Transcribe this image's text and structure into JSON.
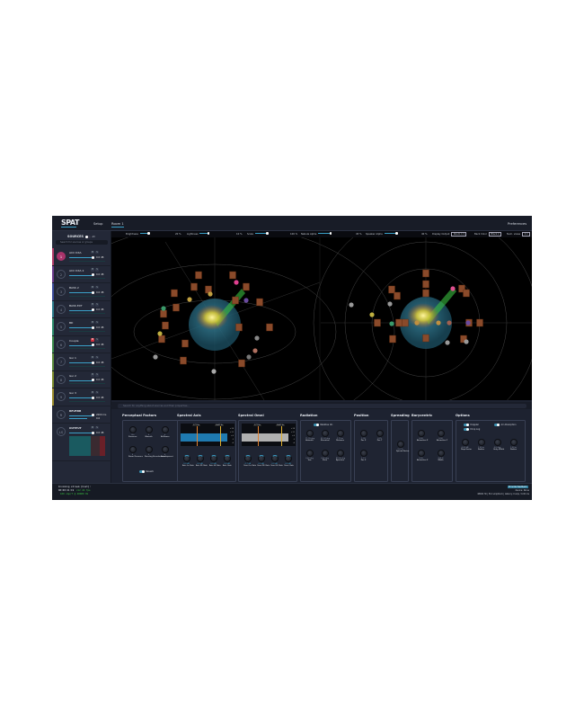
{
  "app": {
    "logo": "SPAT",
    "tabs": [
      "Setup",
      "Room 1"
    ],
    "active_tab": "Room 1",
    "preferences": "Preferences"
  },
  "sidebar": {
    "title": "SOURCES",
    "all_label": "All",
    "search_placeholder": "Search for sources or groups",
    "sources": [
      {
        "num": "1",
        "name": "ACC DXA",
        "value": "0.0 dB",
        "color": "#b03a68",
        "active": true
      },
      {
        "num": "2",
        "name": "ACC DXA 2",
        "value": "0.0 dB",
        "color": "#6a3a8a"
      },
      {
        "num": "3",
        "name": "BASS 2",
        "value": "0.0 dB",
        "color": "#3a4a9a"
      },
      {
        "num": "4",
        "name": "BASS EXT",
        "value": "0.0 dB",
        "color": "#2a7a8a"
      },
      {
        "num": "5",
        "name": "BD",
        "value": "0.0 dB",
        "color": "#2a8a6a"
      },
      {
        "num": "6",
        "name": "Couple",
        "value": "0.0 dB",
        "color": "#3a8a4a",
        "badge": true
      },
      {
        "num": "7",
        "name": "Gui 1",
        "value": "0.0 dB",
        "color": "#5a8a3a"
      },
      {
        "num": "8",
        "name": "Gui 2",
        "value": "0.0 dB",
        "color": "#7a8a2a"
      },
      {
        "num": "9",
        "name": "Gui 3",
        "value": "0.0 dB",
        "color": "#9a8a2a"
      }
    ],
    "reverb": {
      "num": "R",
      "name": "REVERB",
      "value1": "2000 ms",
      "value2": "0.0"
    },
    "output": {
      "num": "LS",
      "name": "OUTPUT",
      "value": "0.0 dB"
    },
    "btn_m": "M",
    "btn_s": "S"
  },
  "toolbar": {
    "brightness_label": "Brightness",
    "brightness": "20 %",
    "lightness_label": "Lightness",
    "lightness": "10 %",
    "scale_label": "Scale",
    "scale": "100 %",
    "nebula_label": "Nebula Alpha",
    "nebula": "45 %",
    "speaker_label": "Speaker Alpha",
    "speaker": "40 %",
    "display_output_label": "Display Output",
    "display_output": "Room 1",
    "back_color_label": "Back Color",
    "back_color": "Black",
    "num_views_label": "Num. views",
    "num_views": "2"
  },
  "search": {
    "placeholder": "Search for anything about sources and their properties..."
  },
  "panels": {
    "perceptual": {
      "title": "Perceptual Factors",
      "knobs": [
        {
          "v": "120",
          "l": "Presence"
        },
        {
          "v": "0",
          "l": "Warmth"
        },
        {
          "v": "0",
          "l": "Brilliance"
        },
        {
          "v": "0",
          "l": "Room Presence"
        },
        {
          "v": "0",
          "l": "Running Reverberance"
        },
        {
          "v": "0",
          "l": "Envelopment"
        }
      ],
      "toggle": "Reverb"
    },
    "spectral_axis": {
      "title": "Spectral Axis",
      "f1": "277 Hz",
      "f2": "3447 Hz",
      "scale": [
        "+18",
        "+12",
        "+6",
        "0",
        "-6"
      ],
      "knobs": [
        {
          "v": "0.0 dB",
          "l": "Axis Lo Gain"
        },
        {
          "v": "0.0 dB",
          "l": "Axis Mi Gain"
        },
        {
          "v": "0.0 dB",
          "l": "Axis Hi Gain"
        },
        {
          "v": "0.0 dB",
          "l": "Axis Gain"
        }
      ]
    },
    "spectral_omni": {
      "title": "Spectral Omni",
      "f1": "277 Hz",
      "f2": "3447 Hz",
      "scale": [
        "+18",
        "+12",
        "+6",
        "0",
        "-6"
      ],
      "knobs": [
        {
          "v": "-1.7 dB",
          "l": "Omni Lo Gain"
        },
        {
          "v": "0.0 dB",
          "l": "Omni Mi Gain"
        },
        {
          "v": "0.0 dB",
          "l": "Omni Hi Gain"
        },
        {
          "v": "0.0 dB",
          "l": "Omni Gain"
        }
      ]
    },
    "radiation": {
      "title": "Radiation",
      "toggle": "Relative dir.",
      "knobs": [
        {
          "v": "71.95 deg",
          "l": "Azimuth"
        },
        {
          "v": "51.02 deg",
          "l": "Elevation"
        },
        {
          "v": "1.70 m",
          "l": "Distance"
        },
        {
          "v": "0.00 deg",
          "l": "Yaw"
        },
        {
          "v": "0.00 deg",
          "l": "Pitch"
        },
        {
          "v": "80.00 deg",
          "l": "Aperture"
        }
      ]
    },
    "position": {
      "title": "Position",
      "knobs": [
        {
          "v": "1.09",
          "l": "Pos X"
        },
        {
          "v": "0.25",
          "l": "Pos Y"
        },
        {
          "v": "1.27",
          "l": "Pos Z"
        }
      ]
    },
    "spreading": {
      "title": "Spreading",
      "knobs": [
        {
          "v": "0.0 %",
          "l": "Spread Factor"
        }
      ]
    },
    "barycentric": {
      "title": "Barycentric",
      "knobs": [
        {
          "v": "0.00",
          "l": "Attraction X"
        },
        {
          "v": "0.00",
          "l": "Attraction Y"
        },
        {
          "v": "0.00",
          "l": "Attraction Z"
        },
        {
          "v": "100 %",
          "l": "Width"
        }
      ]
    },
    "options": {
      "title": "Options",
      "toggles": [
        "Doppler",
        "Air Absorption",
        "Drop Log"
      ],
      "knobs": [
        {
          "v": "6.00 dB",
          "l": "Drop Factor"
        },
        {
          "v": "1.00 m",
          "l": "Radius"
        },
        {
          "v": "0.0 deg",
          "l": "Unity Width"
        },
        {
          "v": "1.00 m",
          "l": "Radius"
        }
      ]
    }
  },
  "status": {
    "stream": "Incoming stream [host]:",
    "timecode": "00:00:21:19",
    "fps": "x12 24 fps",
    "rate": "100 cmp/f @ 48000 Hz",
    "feedback": "Provide feedback",
    "device": "device: None",
    "audio": "48000 Hz | 512 smp/block | latency: 0 smp / 0.00 ms"
  },
  "colors": {
    "accent": "#3aa0c8",
    "background": "#1d2230",
    "viewport": "#000000"
  }
}
